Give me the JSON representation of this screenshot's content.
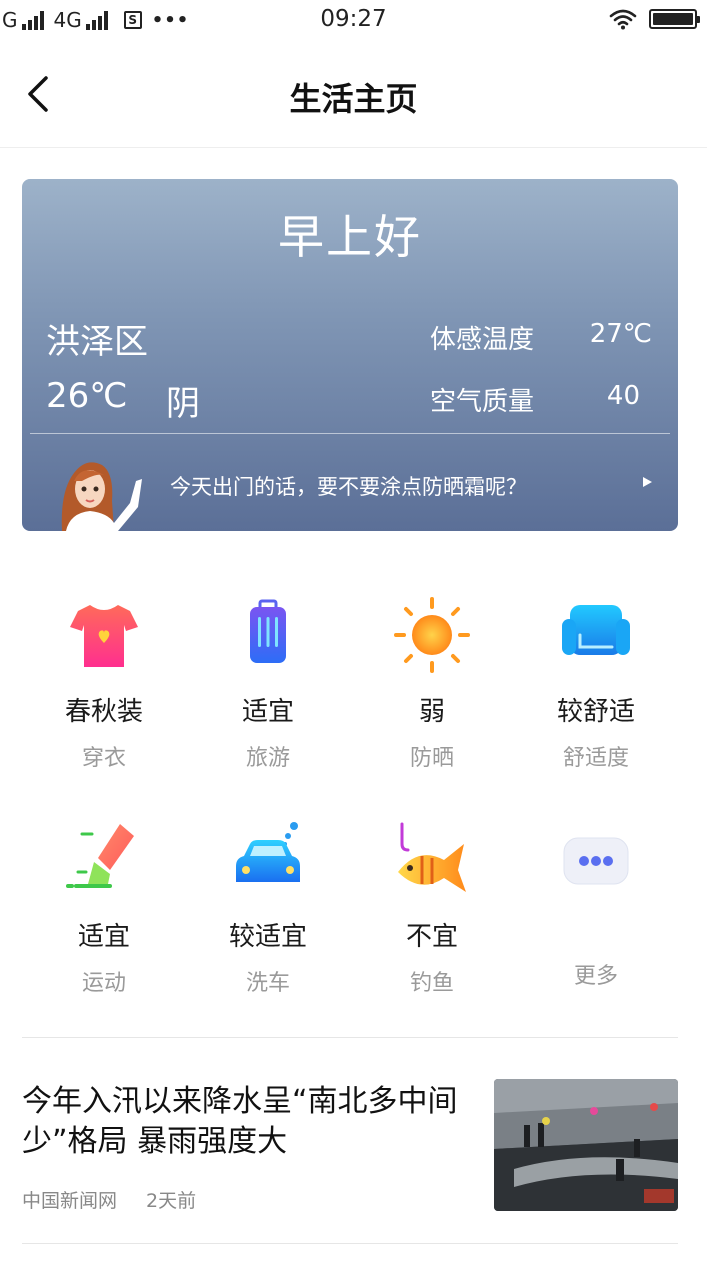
{
  "status_bar": {
    "carrier1": "G",
    "carrier2": "4G",
    "sim_icon": "S",
    "more": "•••",
    "time": "09:27",
    "battery_level": 1.0
  },
  "nav": {
    "title": "生活主页"
  },
  "weather": {
    "greeting": "早上好",
    "location": "洪泽区",
    "temperature": "26℃",
    "condition": "阴",
    "feel_label": "体感温度",
    "feel_value": "27℃",
    "air_label": "空气质量",
    "air_value": "40",
    "tip": "今天出门的话，要不要涂点防晒霜呢？"
  },
  "indices": [
    {
      "value": "春秋装",
      "label": "穿衣",
      "icon": "tshirt-icon"
    },
    {
      "value": "适宜",
      "label": "旅游",
      "icon": "luggage-icon"
    },
    {
      "value": "弱",
      "label": "防晒",
      "icon": "sun-icon"
    },
    {
      "value": "较舒适",
      "label": "舒适度",
      "icon": "sofa-icon"
    },
    {
      "value": "适宜",
      "label": "运动",
      "icon": "sneaker-icon"
    },
    {
      "value": "较适宜",
      "label": "洗车",
      "icon": "car-icon"
    },
    {
      "value": "不宜",
      "label": "钓鱼",
      "icon": "fish-icon"
    },
    {
      "value": "",
      "label": "更多",
      "icon": "more-icon"
    }
  ],
  "news": {
    "title": "今年入汛以来降水呈“南北多中间少”格局 暴雨强度大",
    "source": "中国新闻网",
    "time": "2天前"
  },
  "colors": {
    "card_top": "#9db2c9",
    "card_bottom": "#5b6f97",
    "label_gray": "#9a9a9a"
  }
}
